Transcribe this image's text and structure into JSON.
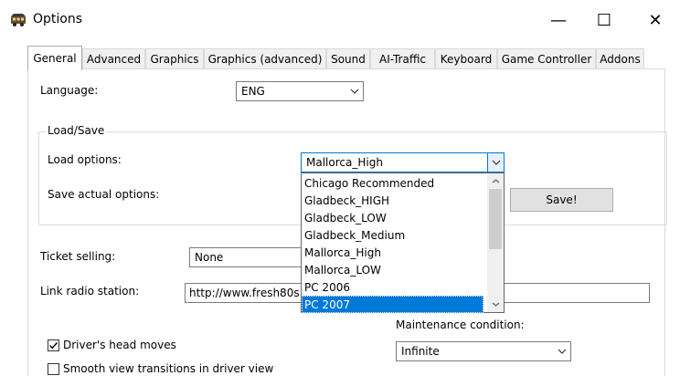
{
  "window": {
    "title": "Options",
    "controls": {
      "minimize": "—",
      "maximize": "☐",
      "close": "✕"
    }
  },
  "tabs": [
    {
      "label": "General",
      "active": true
    },
    {
      "label": "Advanced"
    },
    {
      "label": "Graphics"
    },
    {
      "label": "Graphics (advanced)"
    },
    {
      "label": "Sound"
    },
    {
      "label": "AI-Traffic"
    },
    {
      "label": "Keyboard"
    },
    {
      "label": "Game Controller"
    },
    {
      "label": "Addons"
    }
  ],
  "general": {
    "language_label": "Language:",
    "language_value": "ENG",
    "loadsave": {
      "title": "Load/Save",
      "load_label": "Load options:",
      "load_value": "Mallorca_High",
      "save_label": "Save actual options:",
      "save_button": "Save!",
      "dropdown_options": [
        "Chicago Recommended",
        "Gladbeck_HIGH",
        "Gladbeck_LOW",
        "Gladbeck_Medium",
        "Mallorca_High",
        "Mallorca_LOW",
        "PC 2006",
        "PC 2007"
      ],
      "dropdown_selected": "PC 2007"
    },
    "ticket_label": "Ticket selling:",
    "ticket_value": "None",
    "radio_label": "Link radio station:",
    "radio_value": "http://www.fresh80s",
    "maintenance_label": "Maintenance condition:",
    "maintenance_value": "Infinite",
    "driver_head": {
      "label": "Driver's head moves",
      "checked": true
    },
    "smooth_view": {
      "label": "Smooth view transitions in driver view",
      "checked": false
    }
  },
  "icons": {
    "app": "bus-icon",
    "dropdown_arrow": "chevron-down-icon",
    "scroll_up": "chevron-up-icon",
    "scroll_down": "chevron-down-icon",
    "check": "checkmark-icon"
  },
  "colors": {
    "selection": "#0078d7",
    "button_face": "#e1e1e1",
    "tab_inactive": "#f0f0f0"
  }
}
